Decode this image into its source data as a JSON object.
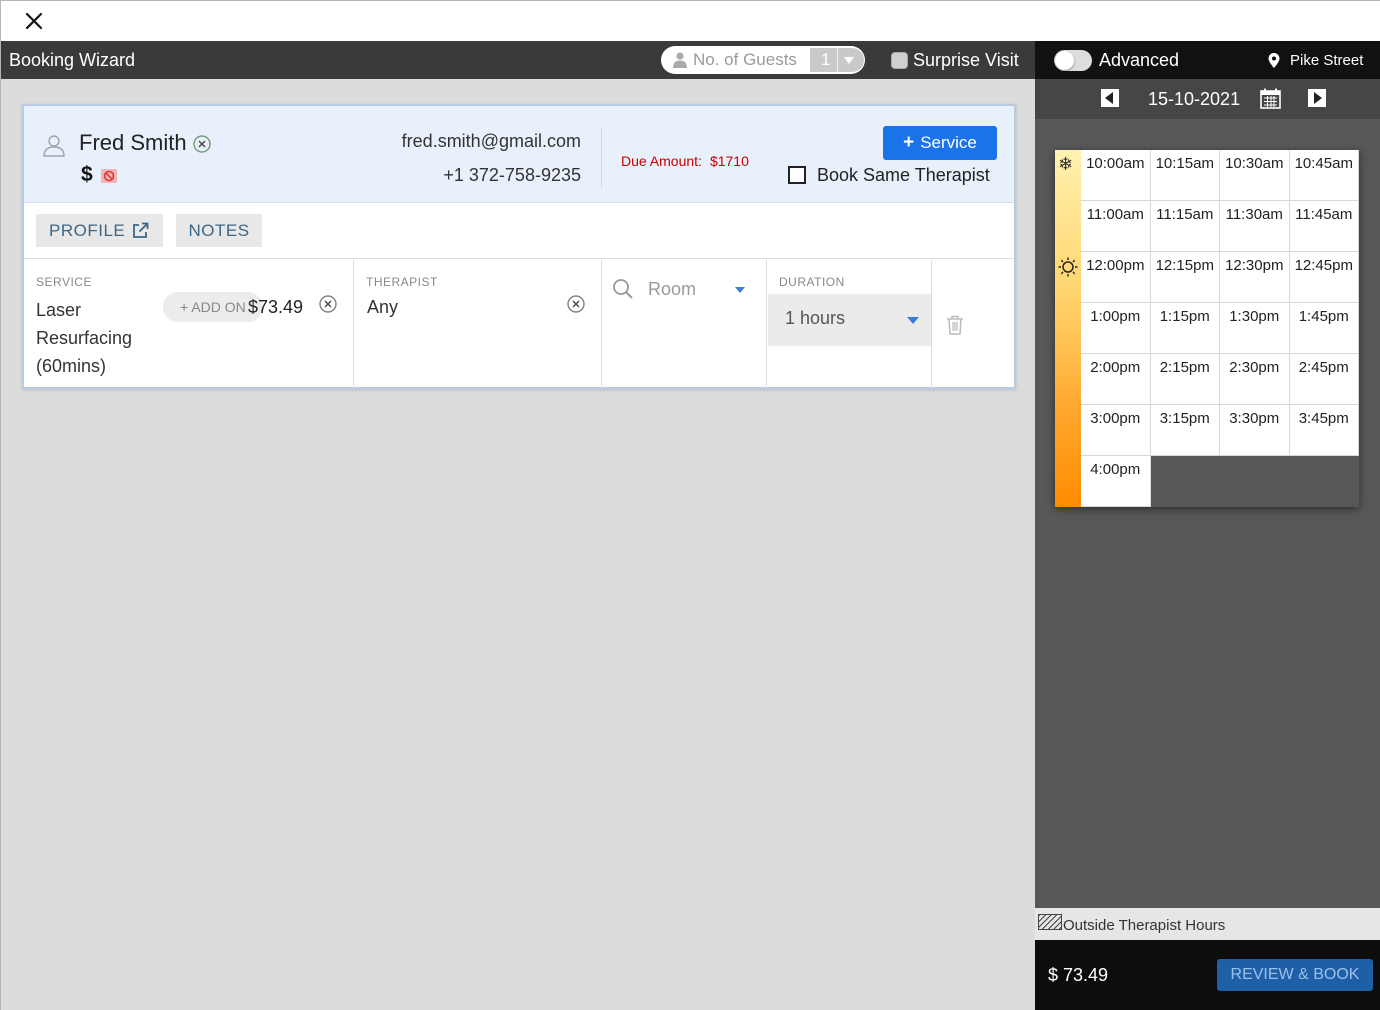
{
  "window": {
    "close_icon": "close-icon"
  },
  "header": {
    "title": "Booking Wizard",
    "guests": {
      "label": "No. of Guests",
      "value": "1"
    },
    "surprise_visit": {
      "label": "Surprise Visit",
      "checked": false
    }
  },
  "side_header": {
    "advanced_label": "Advanced",
    "advanced_on": false,
    "location": "Pike Street"
  },
  "client": {
    "name": "Fred Smith",
    "dollar": "$",
    "email": "fred.smith@gmail.com",
    "phone": "+1 372-758-9235",
    "due_label": "Due Amount:",
    "due_amount": "$1710",
    "service_button": "Service",
    "book_same_therapist": "Book Same Therapist"
  },
  "tabs": {
    "profile": "PROFILE",
    "notes": "NOTES"
  },
  "booking_row": {
    "service_caption": "SERVICE",
    "service_name": "Laser Resurfacing (60mins)",
    "add_on_label": "+ ADD ON",
    "price": "$73.49",
    "therapist_caption": "THERAPIST",
    "therapist": "Any",
    "room_placeholder": "Room",
    "duration_caption": "DURATION",
    "duration": "1 hours"
  },
  "schedule": {
    "date": "15-10-2021",
    "slots": [
      [
        "10:00am",
        "10:15am",
        "10:30am",
        "10:45am"
      ],
      [
        "11:00am",
        "11:15am",
        "11:30am",
        "11:45am"
      ],
      [
        "12:00pm",
        "12:15pm",
        "12:30pm",
        "12:45pm"
      ],
      [
        "1:00pm",
        "1:15pm",
        "1:30pm",
        "1:45pm"
      ],
      [
        "2:00pm",
        "2:15pm",
        "2:30pm",
        "2:45pm"
      ],
      [
        "3:00pm",
        "3:15pm",
        "3:30pm",
        "3:45pm"
      ],
      [
        "4:00pm"
      ]
    ],
    "legend": "Outside Therapist Hours"
  },
  "footer": {
    "total": "$ 73.49",
    "review_button": "REVIEW & BOOK"
  },
  "colors": {
    "accent": "#1a73e8",
    "due": "#c80000",
    "review": "#1e5fa8"
  }
}
